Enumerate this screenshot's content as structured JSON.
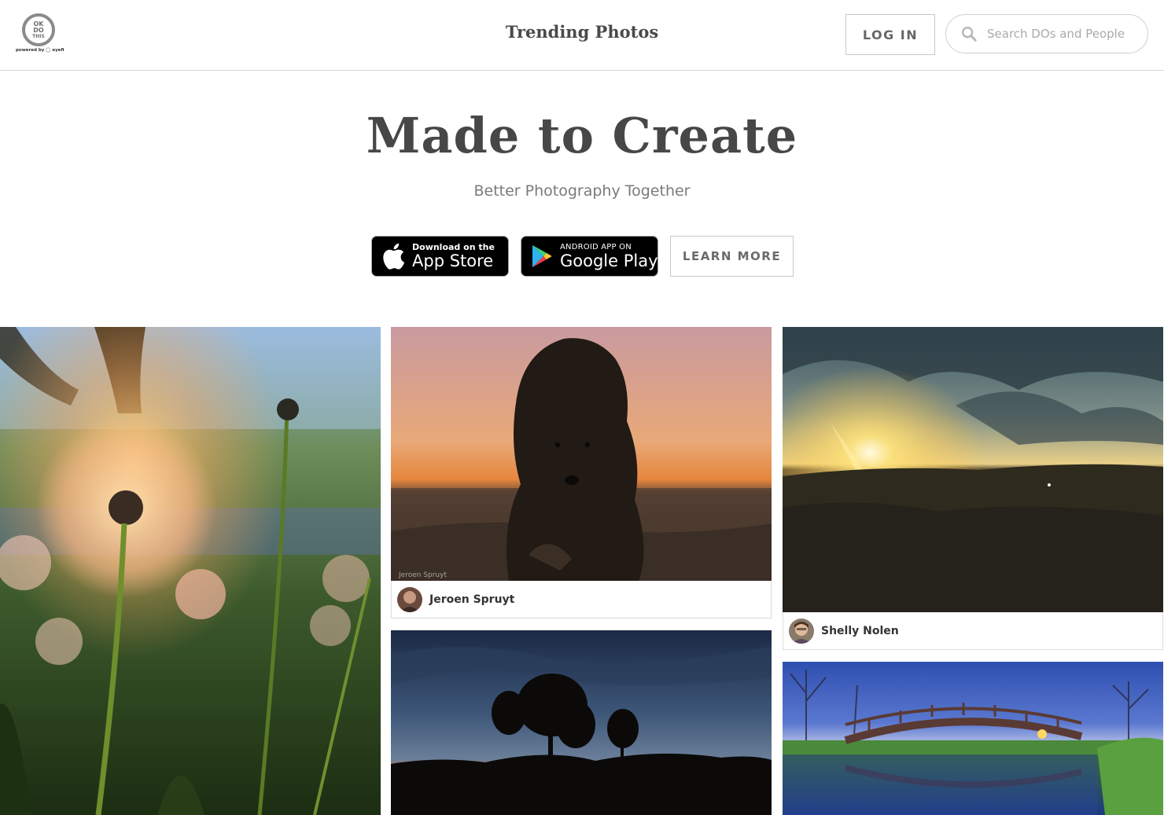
{
  "header": {
    "logo_lines": [
      "OK",
      "DO",
      "THIS"
    ],
    "powered_by": "powered by",
    "powered_brand": "eyefi",
    "title": "Trending Photos",
    "login_label": "LOG IN",
    "search_placeholder": "Search DOs and People"
  },
  "hero": {
    "title": "Made to Create",
    "subtitle": "Better Photography Together",
    "appstore_small": "Download on the",
    "appstore_big": "App Store",
    "gplay_small": "ANDROID APP ON",
    "gplay_big": "Google Play",
    "learn_more_label": "LEARN MORE"
  },
  "photos": [
    {
      "subject": "dandelion-sunset"
    },
    {
      "subject": "dog-on-beach",
      "author": "Jeroen Spruyt",
      "watermark": "Jeroen Spruyt"
    },
    {
      "subject": "sunburst-landscape",
      "author": "Shelly Nolen"
    },
    {
      "subject": "tree-silhouette-sunset"
    },
    {
      "subject": "wooden-bridge-pond"
    }
  ],
  "colors": {
    "text_dark": "#474747",
    "text_muted": "#7a7a7a",
    "border": "#d6d6d6"
  }
}
